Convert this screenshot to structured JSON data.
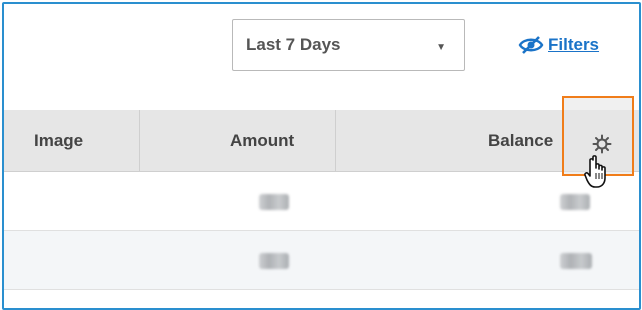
{
  "toolbar": {
    "date_range": {
      "selected": "Last 7 Days"
    },
    "filters_label": "Filters"
  },
  "table": {
    "columns": [
      "Image",
      "Amount",
      "Balance"
    ],
    "rows": [
      {
        "image": "",
        "amount": "",
        "balance": ""
      },
      {
        "image": "",
        "amount": "",
        "balance": ""
      }
    ]
  },
  "icons": {
    "dropdown": "caret-down-icon",
    "filters": "eye-slash-icon",
    "settings": "gear-icon",
    "cursor": "hand-pointer-icon"
  },
  "colors": {
    "frame_border": "#2a8fcf",
    "link": "#1a73c8",
    "highlight": "#f07d1a",
    "header_bg": "#e6e6e6"
  }
}
